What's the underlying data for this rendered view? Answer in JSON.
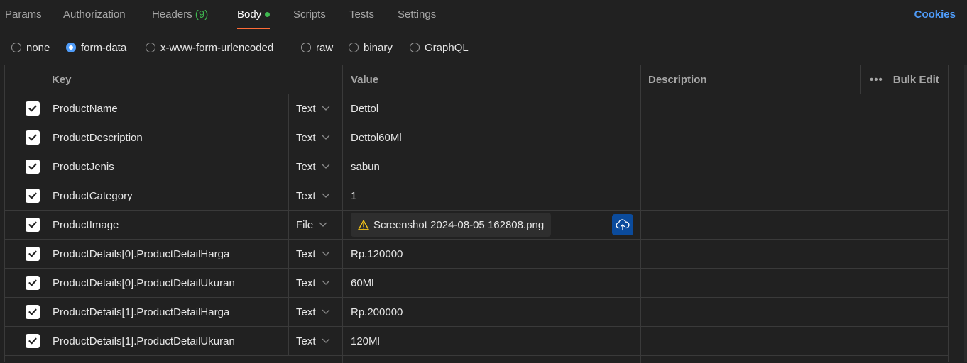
{
  "tabs": [
    {
      "label": "Params"
    },
    {
      "label": "Authorization"
    },
    {
      "label": "Headers",
      "count": "(9)"
    },
    {
      "label": "Body"
    },
    {
      "label": "Scripts"
    },
    {
      "label": "Tests"
    },
    {
      "label": "Settings"
    }
  ],
  "active_tab": "Body",
  "cookies_label": "Cookies",
  "body_types": [
    {
      "label": "none",
      "selected": false
    },
    {
      "label": "form-data",
      "selected": true
    },
    {
      "label": "x-www-form-urlencoded",
      "selected": false
    },
    {
      "label": "raw",
      "selected": false
    },
    {
      "label": "binary",
      "selected": false
    },
    {
      "label": "GraphQL",
      "selected": false
    }
  ],
  "table": {
    "headers": {
      "key": "Key",
      "value": "Value",
      "description": "Description",
      "bulk_edit": "Bulk Edit",
      "more": "•••"
    },
    "rows": [
      {
        "checked": true,
        "key": "ProductName",
        "type": "Text",
        "value": "Dettol"
      },
      {
        "checked": true,
        "key": "ProductDescription",
        "type": "Text",
        "value": "Dettol60Ml"
      },
      {
        "checked": true,
        "key": "ProductJenis",
        "type": "Text",
        "value": "sabun"
      },
      {
        "checked": true,
        "key": "ProductCategory",
        "type": "Text",
        "value": "1"
      },
      {
        "checked": true,
        "key": "ProductImage",
        "type": "File",
        "value": "Screenshot 2024-08-05 162808.png"
      },
      {
        "checked": true,
        "key": "ProductDetails[0].ProductDetailHarga",
        "type": "Text",
        "value": "Rp.120000"
      },
      {
        "checked": true,
        "key": "ProductDetails[0].ProductDetailUkuran",
        "type": "Text",
        "value": "60Ml"
      },
      {
        "checked": true,
        "key": "ProductDetails[1].ProductDetailHarga",
        "type": "Text",
        "value": "Rp.200000"
      },
      {
        "checked": true,
        "key": "ProductDetails[1].ProductDetailUkuran",
        "type": "Text",
        "value": "120Ml"
      }
    ]
  },
  "colors": {
    "background": "#212121",
    "accent_tab": "#ff6c37",
    "link_blue": "#4f9cf9",
    "status_green": "#3fb950",
    "upload_button": "#0b4b9c",
    "warning_yellow": "#f5c518"
  },
  "icons": {
    "checkbox": "check-icon",
    "dropdown": "chevron-down-icon",
    "file_warning": "warning-icon",
    "upload": "cloud-upload-icon",
    "more": "more-horizontal-icon"
  }
}
